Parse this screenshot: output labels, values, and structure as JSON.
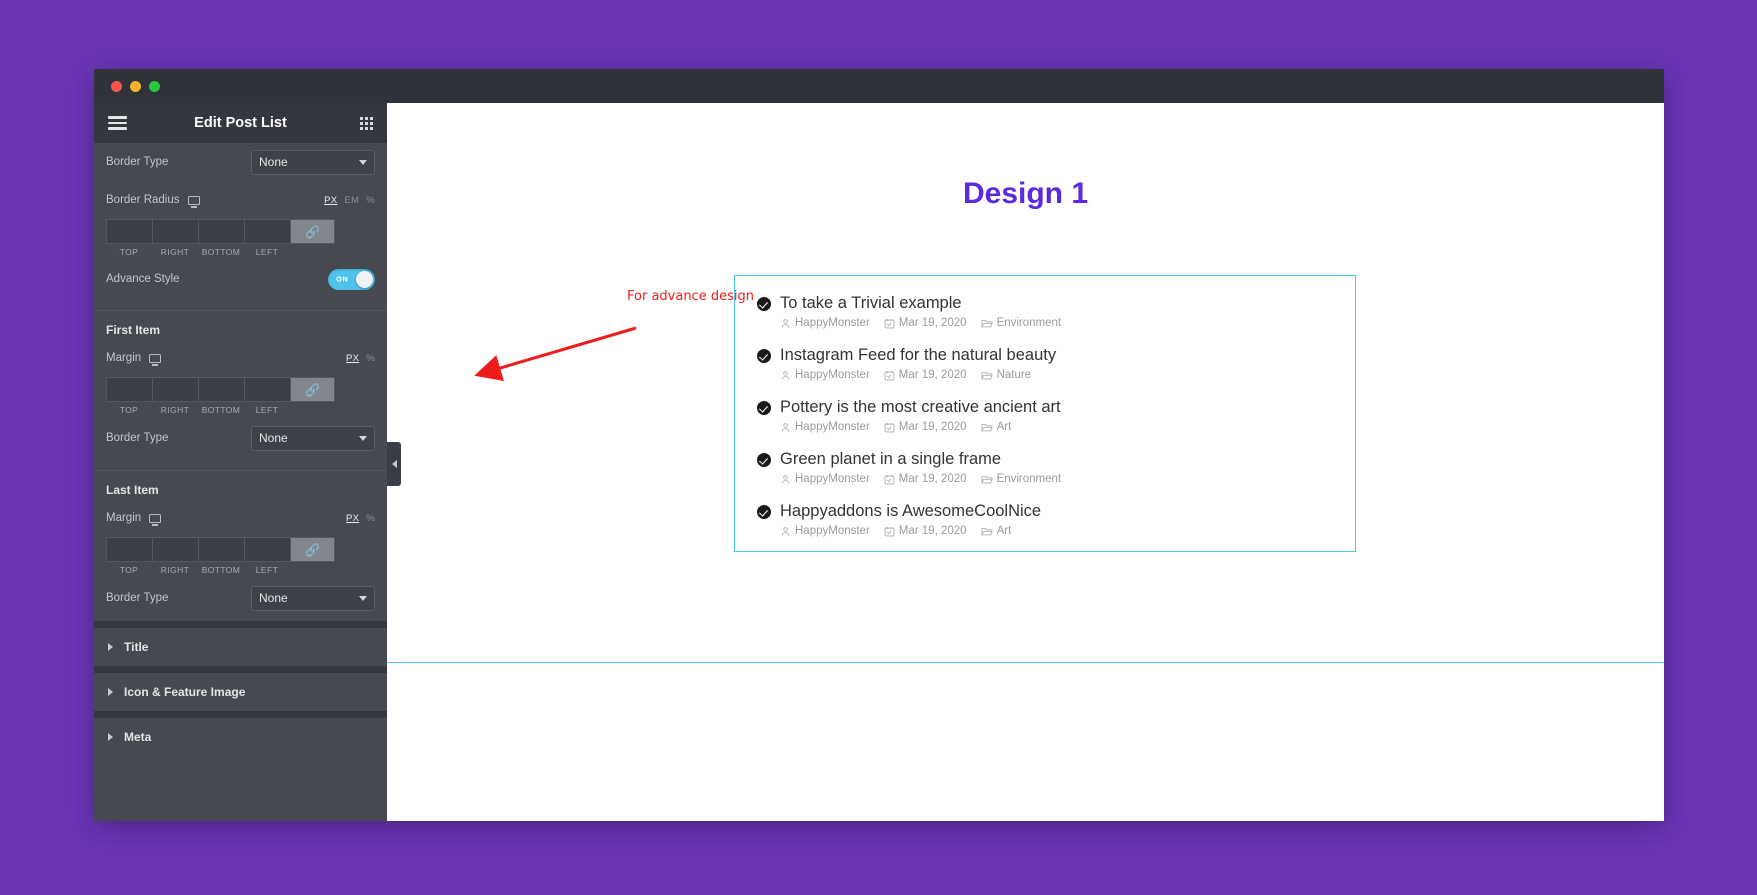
{
  "window": {
    "traffic_lights": [
      "close",
      "minimize",
      "maximize"
    ]
  },
  "panel": {
    "header": {
      "title": "Edit Post List",
      "menu_icon": "hamburger-icon",
      "grid_icon": "grid-icon"
    },
    "controls": {
      "border_type_label": "Border Type",
      "border_type_value": "None",
      "border_radius_label": "Border Radius",
      "margin_label": "Margin",
      "units": [
        "PX",
        "EM",
        "%"
      ],
      "active_unit": "PX",
      "dim_labels": [
        "TOP",
        "RIGHT",
        "BOTTOM",
        "LEFT"
      ],
      "dim_values": [
        "",
        "",
        "",
        ""
      ],
      "link_icon": "link-icon",
      "monitor_icon": "desktop-icon",
      "advance_style_label": "Advance Style",
      "advance_style_state": "ON"
    },
    "sections": {
      "first_item": "First Item",
      "last_item": "Last Item"
    },
    "accordions": [
      {
        "label": "Title"
      },
      {
        "label": "Icon & Feature Image"
      },
      {
        "label": "Meta"
      }
    ],
    "collapse_tab_icon": "chevron-left-icon"
  },
  "canvas": {
    "design_title": "Design 1",
    "posts": [
      {
        "title": "To take a Trivial example",
        "author": "HappyMonster",
        "date": "Mar 19, 2020",
        "category": "Environment"
      },
      {
        "title": "Instagram Feed for the natural beauty",
        "author": "HappyMonster",
        "date": "Mar 19, 2020",
        "category": "Nature"
      },
      {
        "title": "Pottery is the most creative ancient art",
        "author": "HappyMonster",
        "date": "Mar 19, 2020",
        "category": "Art"
      },
      {
        "title": "Green planet in a single frame",
        "author": "HappyMonster",
        "date": "Mar 19, 2020",
        "category": "Environment"
      },
      {
        "title": "Happyaddons is AwesomeCoolNice",
        "author": "HappyMonster",
        "date": "Mar 19, 2020",
        "category": "Art"
      }
    ]
  },
  "annotation": {
    "text": "For advance design",
    "color": "#ee1c1c"
  },
  "colors": {
    "desktop_background": "#6b35b8",
    "panel_background": "#46494f",
    "panel_header": "#34373d",
    "accent_cyan": "#4fc6e8",
    "design_title": "#5b2ae0",
    "toggle_on": "#4ec3ec"
  }
}
